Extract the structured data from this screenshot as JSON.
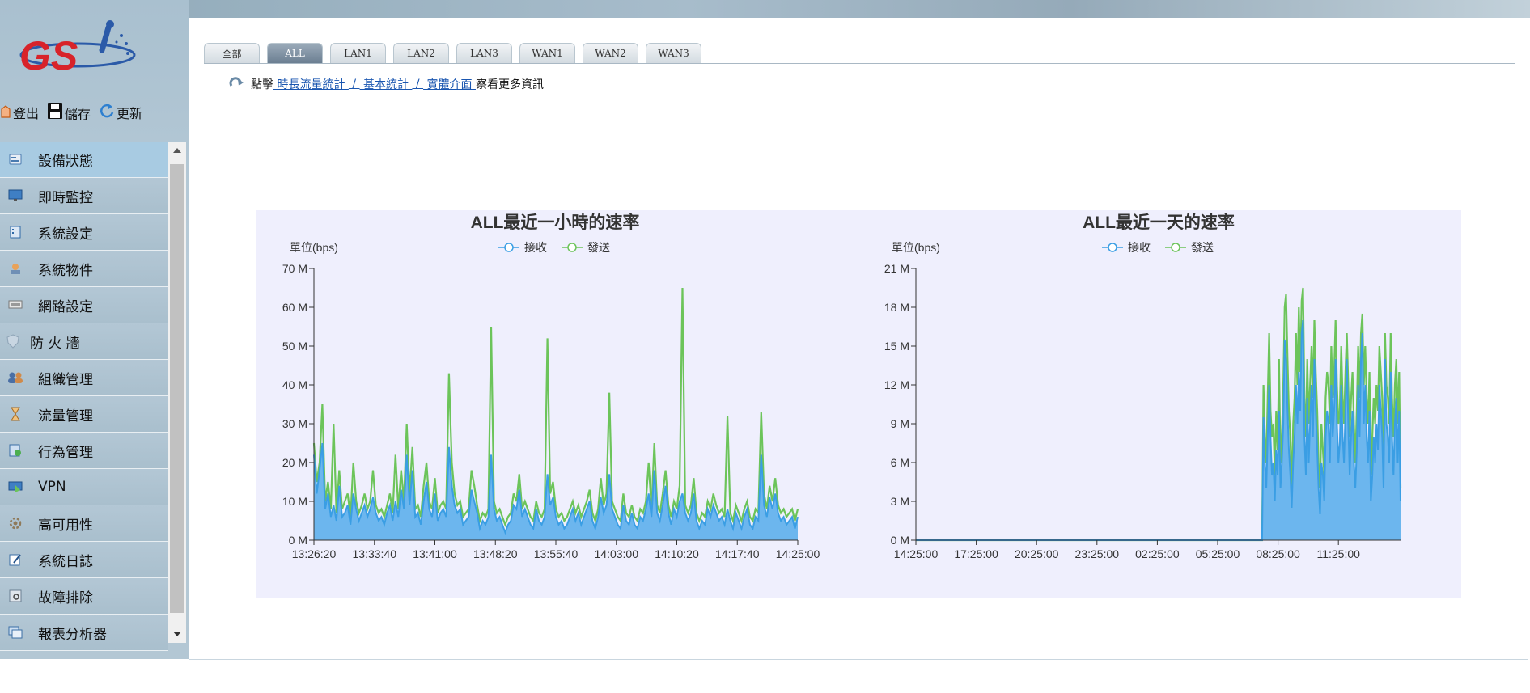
{
  "toolbar": {
    "logout_label": "登出",
    "save_label": "儲存",
    "refresh_label": "更新"
  },
  "sidebar": {
    "items": [
      {
        "label": "設備狀態",
        "icon": "device-status-icon",
        "active": true
      },
      {
        "label": "即時監控",
        "icon": "monitor-icon"
      },
      {
        "label": "系統設定",
        "icon": "settings-book-icon"
      },
      {
        "label": "系統物件",
        "icon": "objects-icon"
      },
      {
        "label": "網路設定",
        "icon": "network-icon"
      },
      {
        "label": "防 火 牆",
        "icon": "shield-icon"
      },
      {
        "label": "組織管理",
        "icon": "users-icon"
      },
      {
        "label": "流量管理",
        "icon": "hourglass-icon"
      },
      {
        "label": "行為管理",
        "icon": "behavior-icon"
      },
      {
        "label": "VPN",
        "icon": "vpn-icon"
      },
      {
        "label": "高可用性",
        "icon": "gear-icon"
      },
      {
        "label": "系統日誌",
        "icon": "log-icon"
      },
      {
        "label": "故障排除",
        "icon": "troubleshoot-icon"
      },
      {
        "label": "報表分析器",
        "icon": "report-icon"
      }
    ]
  },
  "tabs": [
    "全部",
    "ALL",
    "LAN1",
    "LAN2",
    "LAN3",
    "WAN1",
    "WAN2",
    "WAN3"
  ],
  "active_tab": "ALL",
  "info_bar": {
    "prefix": "點擊",
    "links": [
      " 時長流量統計 ",
      " 基本統計 ",
      " 實體介面 "
    ],
    "separator": " / ",
    "suffix": "察看更多資訊"
  },
  "colors": {
    "receive": "#3a9ee4",
    "receive_fill": "#6cb6ee",
    "send": "#6cc45a",
    "panel_bg": "#efeffd"
  },
  "chart_data": [
    {
      "type": "area",
      "title": "ALL最近一小時的速率",
      "ylabel": "單位(bps)",
      "legend": [
        "接收",
        "發送"
      ],
      "legend_position": "top-center",
      "ylim": [
        0,
        70000000
      ],
      "yticks": [
        "0 M",
        "10 M",
        "20 M",
        "30 M",
        "40 M",
        "50 M",
        "60 M",
        "70 M"
      ],
      "xticks": [
        "13:26:20",
        "13:33:40",
        "13:41:00",
        "13:48:20",
        "13:55:40",
        "14:03:00",
        "14:10:20",
        "14:17:40",
        "14:25:00"
      ],
      "series": [
        {
          "name": "接收",
          "values": [
            22,
            12,
            18,
            25,
            8,
            12,
            6,
            9,
            5,
            14,
            6,
            7,
            9,
            4,
            12,
            8,
            5,
            7,
            9,
            6,
            8,
            11,
            7,
            5,
            6,
            4,
            7,
            9,
            5,
            10,
            6,
            13,
            8,
            22,
            9,
            18,
            6,
            7,
            4,
            10,
            15,
            8,
            6,
            12,
            5,
            7,
            8,
            6,
            24,
            14,
            9,
            7,
            8,
            4,
            5,
            6,
            13,
            10,
            7,
            3,
            5,
            4,
            6,
            22,
            8,
            5,
            6,
            4,
            2,
            4,
            5,
            9,
            8,
            13,
            6,
            8,
            6,
            4,
            3,
            8,
            5,
            4,
            6,
            17,
            9,
            11,
            6,
            4,
            5,
            3,
            4,
            6,
            8,
            5,
            7,
            4,
            6,
            8,
            10,
            5,
            3,
            6,
            11,
            7,
            9,
            17,
            8,
            6,
            4,
            3,
            9,
            5,
            4,
            7,
            4,
            3,
            6,
            5,
            8,
            12,
            6,
            18,
            7,
            5,
            9,
            14,
            7,
            4,
            8,
            6,
            10,
            12,
            7,
            5,
            7,
            12,
            5,
            3,
            5,
            4,
            8,
            6,
            9,
            7,
            5,
            6,
            4,
            8,
            5,
            3,
            7,
            5,
            3,
            6,
            8,
            4,
            3,
            6,
            5,
            22,
            9,
            6,
            11,
            8,
            12,
            7,
            5,
            6,
            4,
            5,
            6,
            3,
            6
          ]
        },
        {
          "name": "發送",
          "values": [
            25,
            15,
            20,
            35,
            10,
            15,
            8,
            30,
            7,
            18,
            8,
            10,
            12,
            6,
            20,
            10,
            7,
            9,
            12,
            8,
            10,
            18,
            9,
            7,
            8,
            6,
            9,
            12,
            7,
            22,
            8,
            18,
            10,
            30,
            12,
            24,
            8,
            9,
            6,
            14,
            20,
            10,
            8,
            16,
            7,
            9,
            10,
            8,
            43,
            20,
            12,
            9,
            10,
            6,
            7,
            8,
            18,
            14,
            9,
            5,
            7,
            6,
            8,
            55,
            10,
            7,
            8,
            6,
            4,
            6,
            7,
            12,
            10,
            17,
            8,
            10,
            8,
            6,
            5,
            10,
            7,
            6,
            8,
            52,
            12,
            15,
            8,
            6,
            7,
            5,
            6,
            8,
            10,
            7,
            9,
            6,
            8,
            10,
            13,
            7,
            5,
            8,
            16,
            9,
            12,
            38,
            10,
            8,
            6,
            5,
            12,
            7,
            6,
            9,
            6,
            5,
            8,
            7,
            10,
            20,
            8,
            25,
            9,
            7,
            12,
            18,
            9,
            6,
            10,
            8,
            14,
            65,
            9,
            7,
            9,
            16,
            7,
            5,
            7,
            6,
            10,
            8,
            12,
            9,
            7,
            8,
            6,
            32,
            7,
            5,
            9,
            7,
            5,
            8,
            10,
            6,
            5,
            8,
            7,
            33,
            12,
            8,
            14,
            10,
            16,
            9,
            7,
            8,
            6,
            7,
            8,
            5,
            8
          ]
        }
      ]
    },
    {
      "type": "area",
      "title": "ALL最近一天的速率",
      "ylabel": "單位(bps)",
      "legend": [
        "接收",
        "發送"
      ],
      "legend_position": "top-center",
      "ylim": [
        0,
        21000000
      ],
      "yticks": [
        "0 M",
        "3 M",
        "6 M",
        "9 M",
        "12 M",
        "15 M",
        "18 M",
        "21 M"
      ],
      "xticks": [
        "14:25:00",
        "17:25:00",
        "20:25:00",
        "23:25:00",
        "02:25:00",
        "05:25:00",
        "08:25:00",
        "11:25:00"
      ],
      "series": [
        {
          "name": "接收",
          "values": [
            0,
            0,
            0,
            0,
            0,
            0,
            0,
            0,
            0,
            0,
            0,
            0,
            0,
            0,
            0,
            0,
            0,
            0,
            0,
            0,
            0,
            0,
            0,
            0,
            0,
            0,
            0,
            0,
            0,
            0,
            0,
            0,
            0,
            0,
            0,
            0,
            0,
            0,
            0,
            0,
            0,
            0,
            0,
            0,
            0,
            0,
            0,
            0,
            0,
            0,
            0,
            0,
            0,
            0,
            0,
            0,
            0,
            0,
            0,
            0,
            0,
            0,
            0,
            0,
            0,
            0,
            0,
            0,
            0,
            0,
            0,
            0,
            0,
            0,
            0,
            0,
            0,
            0,
            0,
            0,
            0,
            0,
            0,
            0,
            0,
            0,
            0,
            0,
            0,
            0,
            0,
            0,
            0,
            0,
            0,
            0,
            0,
            0,
            0,
            0,
            0,
            0,
            0,
            0,
            0,
            0,
            0,
            0,
            0,
            0,
            0,
            0,
            0,
            0,
            0,
            0,
            0,
            0,
            0,
            0,
            0,
            0,
            0,
            0,
            0,
            0,
            0,
            0,
            0,
            0,
            0,
            0,
            0,
            0,
            0,
            0,
            0,
            0,
            0,
            0,
            0,
            0,
            0,
            0,
            0,
            0,
            0,
            0,
            0,
            0,
            0,
            0,
            0,
            0,
            0,
            0,
            0,
            0,
            0,
            0,
            0,
            0,
            0,
            0,
            0,
            0,
            0,
            0,
            0,
            0,
            0,
            0,
            0,
            0,
            0,
            0,
            0,
            0,
            0,
            0,
            0,
            0,
            0,
            0,
            0,
            0,
            0,
            0,
            0,
            0,
            0,
            0,
            0,
            0,
            0,
            0,
            0,
            0,
            0,
            0,
            0,
            0,
            0,
            0,
            0,
            0,
            0,
            0,
            0,
            0,
            0,
            0,
            0,
            0,
            0,
            0,
            0,
            0,
            0,
            0,
            0,
            0,
            0,
            0,
            0,
            0,
            0,
            0,
            0,
            0,
            0,
            0,
            0,
            0,
            0,
            0,
            0,
            0,
            0,
            0,
            0,
            0,
            0,
            0,
            0,
            0,
            9.5,
            6,
            4,
            8,
            12,
            8,
            5,
            6,
            3,
            7,
            5,
            10,
            4,
            6,
            9,
            15.5,
            14,
            10,
            7,
            5,
            2.5,
            6,
            8,
            12,
            9,
            13,
            10,
            16,
            17,
            8,
            5,
            11,
            6,
            9,
            12,
            8,
            14,
            10,
            7,
            4,
            2,
            6,
            5,
            3,
            8,
            10,
            9,
            6,
            12,
            8,
            10,
            14,
            9,
            6,
            7.5,
            12,
            8,
            6,
            10,
            14,
            9,
            5,
            8,
            10,
            6,
            4,
            7,
            12,
            8,
            14,
            16,
            9,
            12,
            8,
            6,
            10,
            3,
            5,
            8,
            6,
            9,
            7,
            12,
            10,
            8,
            4,
            14,
            9,
            8,
            6,
            13,
            8,
            5,
            9,
            11,
            6,
            10,
            3
          ]
        },
        {
          "name": "發送",
          "values": [
            0,
            0,
            0,
            0,
            0,
            0,
            0,
            0,
            0,
            0,
            0,
            0,
            0,
            0,
            0,
            0,
            0,
            0,
            0,
            0,
            0,
            0,
            0,
            0,
            0,
            0,
            0,
            0,
            0,
            0,
            0,
            0,
            0,
            0,
            0,
            0,
            0,
            0,
            0,
            0,
            0,
            0,
            0,
            0,
            0,
            0,
            0,
            0,
            0,
            0,
            0,
            0,
            0,
            0,
            0,
            0,
            0,
            0,
            0,
            0,
            0,
            0,
            0,
            0,
            0,
            0,
            0,
            0,
            0,
            0,
            0,
            0,
            0,
            0,
            0,
            0,
            0,
            0,
            0,
            0,
            0,
            0,
            0,
            0,
            0,
            0,
            0,
            0,
            0,
            0,
            0,
            0,
            0,
            0,
            0,
            0,
            0,
            0,
            0,
            0,
            0,
            0,
            0,
            0,
            0,
            0,
            0,
            0,
            0,
            0,
            0,
            0,
            0,
            0,
            0,
            0,
            0,
            0,
            0,
            0,
            0,
            0,
            0,
            0,
            0,
            0,
            0,
            0,
            0,
            0,
            0,
            0,
            0,
            0,
            0,
            0,
            0,
            0,
            0,
            0,
            0,
            0,
            0,
            0,
            0,
            0,
            0,
            0,
            0,
            0,
            0,
            0,
            0,
            0,
            0,
            0,
            0,
            0,
            0,
            0,
            0,
            0,
            0,
            0,
            0,
            0,
            0,
            0,
            0,
            0,
            0,
            0,
            0,
            0,
            0,
            0,
            0,
            0,
            0,
            0,
            0,
            0,
            0,
            0,
            0,
            0,
            0,
            0,
            0,
            0,
            0,
            0,
            0,
            0,
            0,
            0,
            0,
            0,
            0,
            0,
            0,
            0,
            0,
            0,
            0,
            0,
            0,
            0,
            0,
            0,
            0,
            0,
            0,
            0,
            0,
            0,
            0,
            0,
            0,
            0,
            0,
            0,
            0,
            0,
            0,
            0,
            0,
            0,
            0,
            0,
            0,
            0,
            0,
            0,
            0,
            0,
            0,
            0,
            0,
            0,
            0,
            0,
            0,
            0,
            0,
            0,
            12,
            8,
            6,
            11,
            16,
            10,
            8,
            9,
            5,
            10,
            7,
            14,
            6,
            8,
            12,
            18,
            19,
            14,
            10,
            8,
            4,
            9,
            11,
            16,
            12,
            18,
            13,
            18.5,
            19.5,
            11,
            8,
            14,
            9,
            12,
            15,
            11,
            17,
            13,
            10,
            6,
            4,
            9,
            7,
            5,
            11,
            13,
            12,
            9,
            15,
            11,
            13,
            17,
            12,
            9,
            10,
            15,
            11,
            9,
            13,
            16,
            12,
            8,
            11,
            13,
            9,
            6,
            10,
            15,
            11,
            16,
            17.5,
            12,
            15,
            11,
            9,
            13,
            5,
            8,
            11,
            9,
            12,
            10,
            15,
            13,
            11,
            6,
            16,
            12,
            11,
            9,
            16,
            11,
            8,
            12,
            14,
            9,
            13,
            4
          ]
        }
      ]
    }
  ]
}
